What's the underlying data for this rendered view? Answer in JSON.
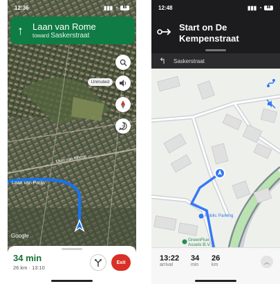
{
  "left_screen": {
    "status_bar": {
      "time": "12:36",
      "battery": "85"
    },
    "nav_card": {
      "arrow": "↑",
      "street": "Laan van Rome",
      "toward_label": "toward",
      "toward_street": "Saskerstraat"
    },
    "controls": {
      "search_icon": "search-icon",
      "sound_icon": "speaker-icon",
      "unmuted_label": "Unmuted",
      "compass_icon": "compass-icon",
      "report_icon": "report-icon"
    },
    "map_labels": {
      "google_logo": "Google",
      "street_parijs": "Laan van Parijs",
      "street_athene": "Laan van Athene"
    },
    "bottom_card": {
      "eta": "34 min",
      "details": "26 km · 13:10",
      "exit_label": "Exit"
    },
    "colors": {
      "nav_green": "#0f7b45",
      "route_blue": "#1a73e8",
      "exit_red": "#d93025"
    }
  },
  "right_screen": {
    "status_bar": {
      "time": "12:48",
      "battery": "88"
    },
    "header": {
      "instruction": "Start on De Kempenstraat"
    },
    "then_bar": {
      "street": "Saskerstraat"
    },
    "map_labels": {
      "public_parking": "Public Parking",
      "greenflux_1": "GreenFlux",
      "greenflux_2": "Assets B.V."
    },
    "bottom_bar": {
      "stats": [
        {
          "value": "13:22",
          "label": "arrival"
        },
        {
          "value": "34",
          "label": "min"
        },
        {
          "value": "26",
          "label": "km"
        }
      ]
    },
    "colors": {
      "route_blue": "#3478f6",
      "header_bg": "#1c1c1e"
    }
  }
}
